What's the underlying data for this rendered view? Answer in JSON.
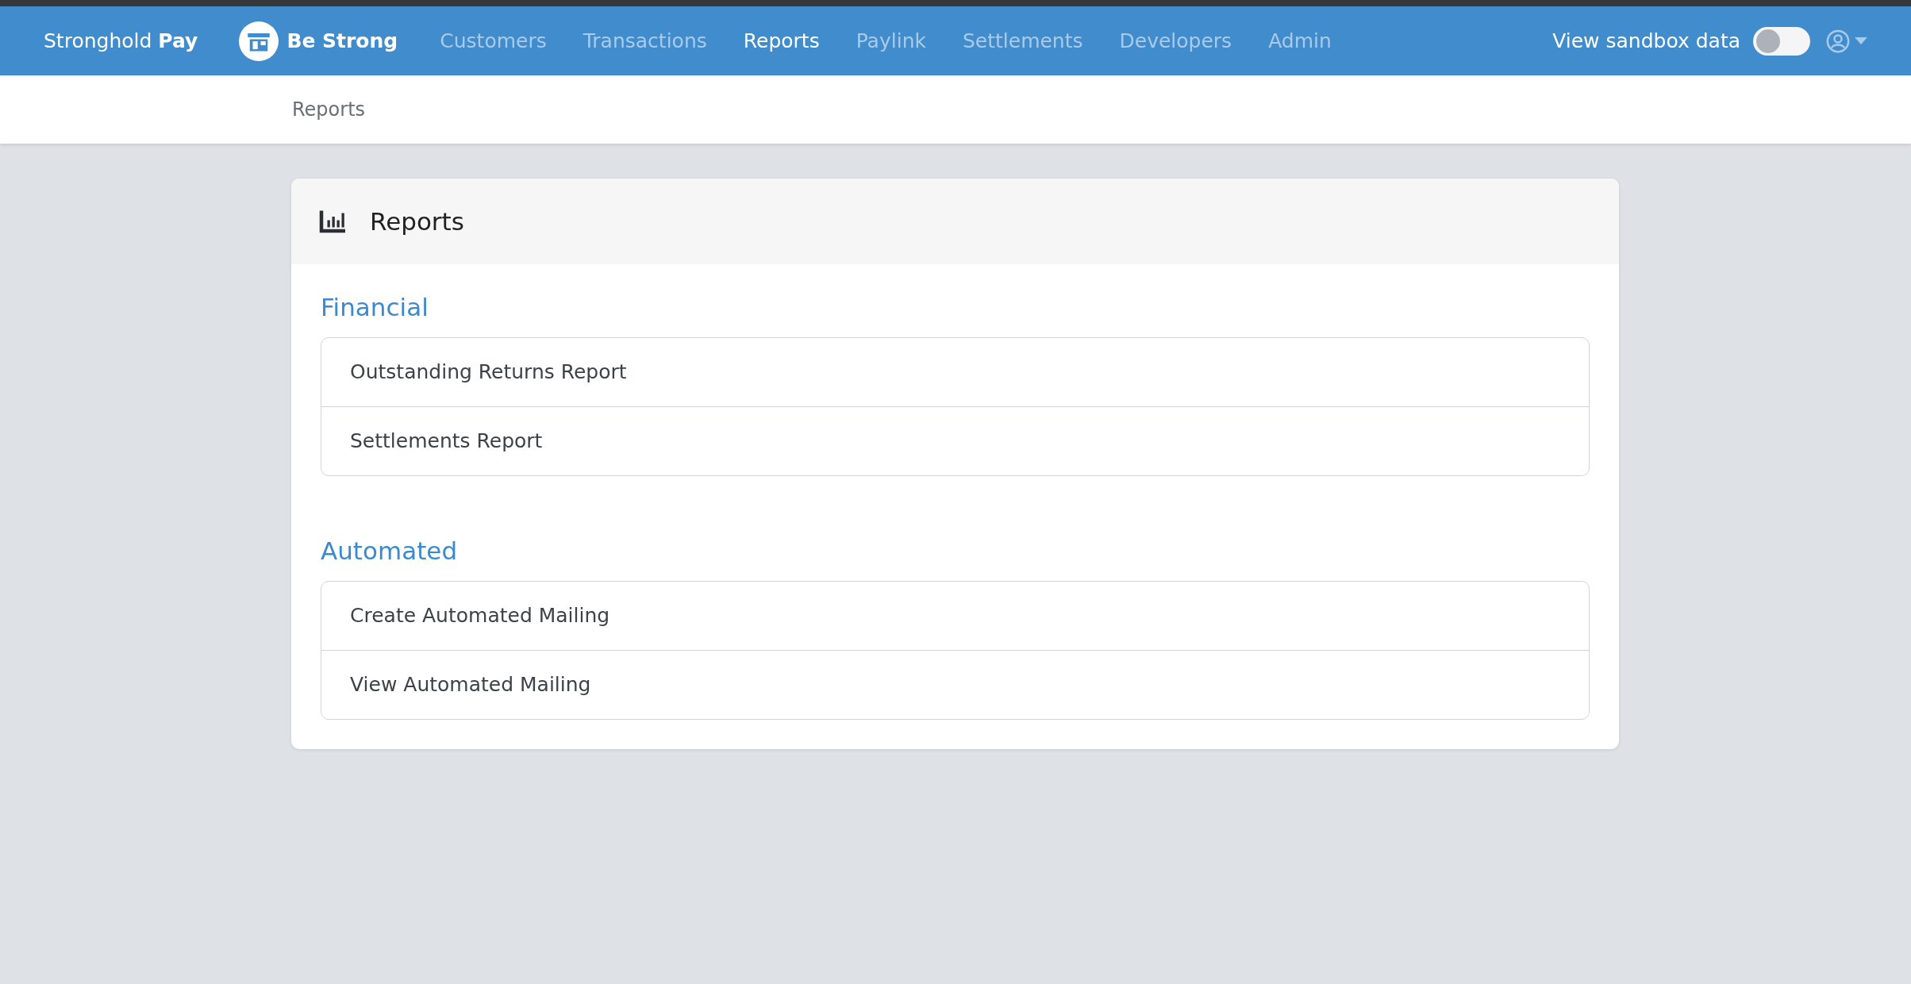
{
  "brand": "Stronghold **Pay**",
  "merchant": "Be Strong",
  "nav": [
    {
      "label": "Customers",
      "selected": false
    },
    {
      "label": "Transactions",
      "selected": false
    },
    {
      "label": "Reports",
      "selected": true
    },
    {
      "label": "Paylink",
      "selected": false
    },
    {
      "label": "Settlements",
      "selected": false
    },
    {
      "label": "Developers",
      "selected": false
    },
    {
      "label": "Admin",
      "selected": false
    }
  ],
  "sandbox": {
    "label": "View sandbox data",
    "on": false
  },
  "breadcrumb": "Reports",
  "card": {
    "title": "Reports",
    "sections": [
      {
        "heading": "Financial",
        "items": [
          "Outstanding Returns Report",
          "Settlements Report"
        ]
      },
      {
        "heading": "Automated",
        "items": [
          "Create Automated Mailing",
          "View Automated Mailing"
        ]
      }
    ]
  }
}
